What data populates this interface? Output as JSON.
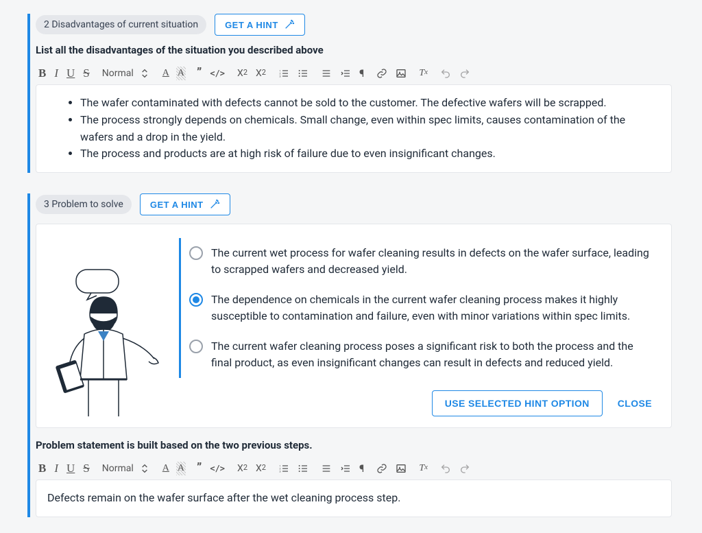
{
  "section2": {
    "badge": "2 Disadvantages of current situation",
    "hint_btn": "GET A HINT",
    "prompt": "List all the disadvantages of the situation you described above",
    "bullets": [
      "The wafer contaminated with defects cannot be sold to the customer. The defective wafers will be scrapped.",
      "The process strongly depends on chemicals. Small change, even within spec limits, causes contamination of the wafers and a drop in the yield.",
      "The process and products are at high risk of failure due to even insignificant changes."
    ]
  },
  "section3": {
    "badge": "3 Problem to solve",
    "hint_btn": "GET A HINT",
    "options": [
      "The current wet process for wafer cleaning results in defects on the wafer surface, leading to scrapped wafers and decreased yield.",
      "The dependence on chemicals in the current wafer cleaning process makes it highly susceptible to contamination and failure, even with minor variations within spec limits.",
      "The current wafer cleaning process poses a significant risk to both the process and the final product, as even insignificant changes can result in defects and reduced yield."
    ],
    "selected_index": 1,
    "use_btn": "USE SELECTED HINT OPTION",
    "close_btn": "CLOSE",
    "prompt2": "Problem statement is built based on the two previous steps.",
    "editor_value": "Defects remain on the wafer surface after the wet cleaning process step."
  },
  "toolbar": {
    "normal": "Normal"
  }
}
